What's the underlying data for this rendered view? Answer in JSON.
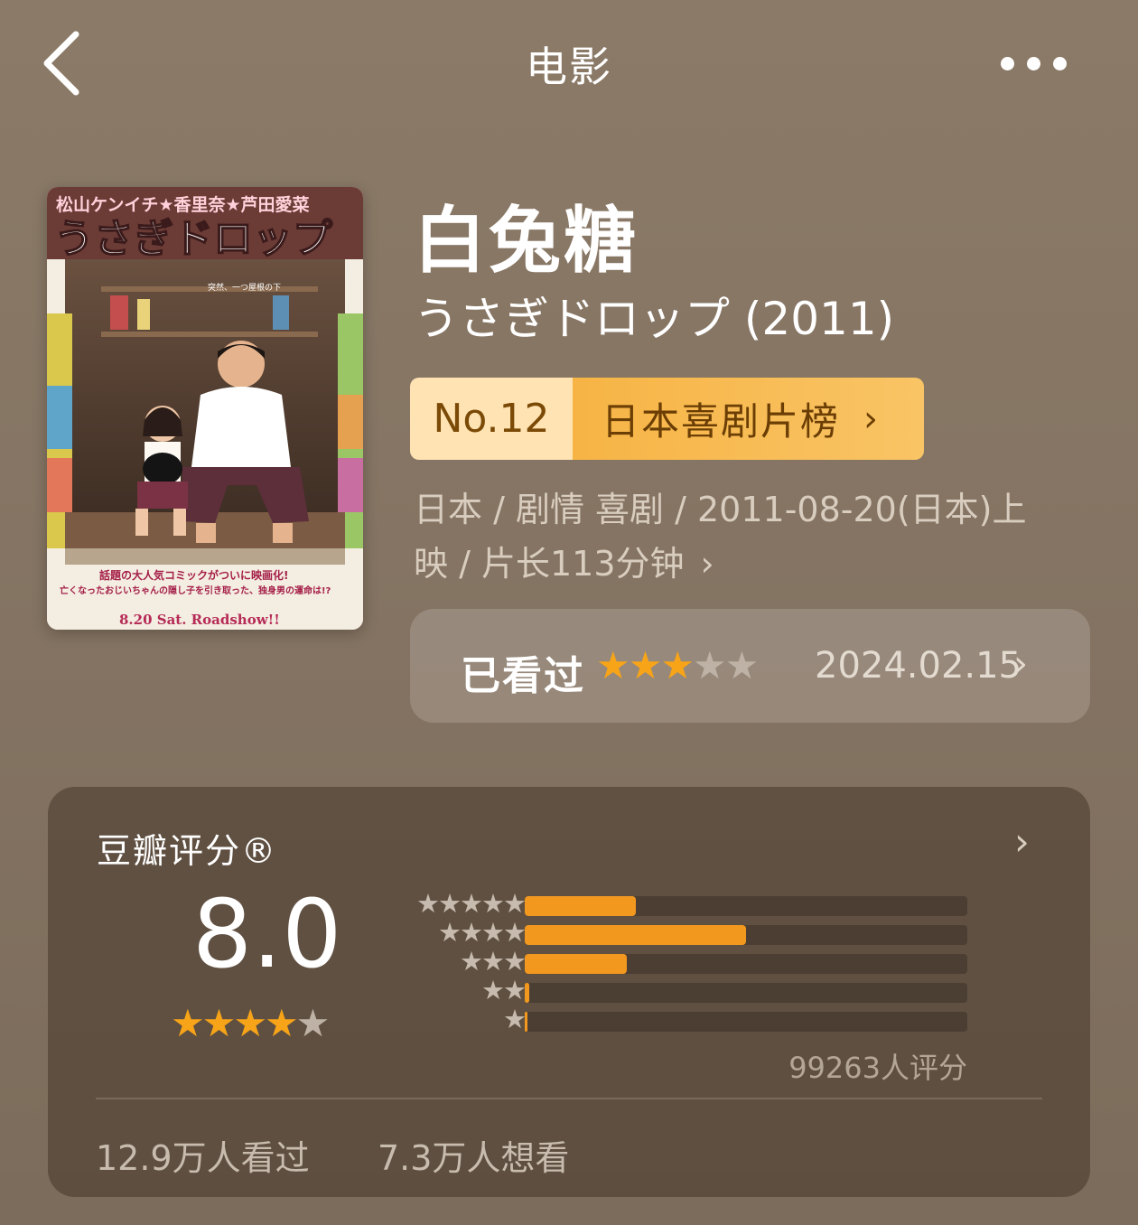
{
  "header": {
    "back_icon": "chevron-left-icon",
    "title": "电影",
    "more_icon": "more-dots-icon"
  },
  "poster": {
    "cast_line": "松山ケンイチ★香里奈★芦田愛菜",
    "title_jp": "うさぎドロップ",
    "tagline": "突然、一つ屋根の下",
    "promo_line1": "話題の大人気コミックがついに映画化!",
    "promo_line2": "亡くなったおじいちゃんの隠し子を引き取った、独身男の運命は!?",
    "release": "8.20 Sat. Roadshow!!"
  },
  "movie": {
    "title": "白兔糖",
    "subtitle": "うさぎドロップ  (2011)"
  },
  "rank": {
    "number": "No.12",
    "list_name": "日本喜剧片榜",
    "chevron": "›"
  },
  "meta": {
    "line1": "日本  /  剧情  喜剧  /  2011-08-20(日本)上",
    "line2": "映  /  片长113分钟",
    "chevron": "›"
  },
  "watched": {
    "label": "已看过",
    "user_rating": 3,
    "max_rating": 5,
    "date": "2024.02.15",
    "chevron": "›"
  },
  "rating": {
    "title": "豆瓣评分®",
    "chevron": "›",
    "score": "8.0",
    "score_stars": 4,
    "distribution": [
      {
        "stars": 5,
        "fraction": 0.25
      },
      {
        "stars": 4,
        "fraction": 0.5
      },
      {
        "stars": 3,
        "fraction": 0.23
      },
      {
        "stars": 2,
        "fraction": 0.01
      },
      {
        "stars": 1,
        "fraction": 0.002
      }
    ],
    "count": "99263人评分",
    "watched_count": "12.9万人看过",
    "want_count": "7.3万人想看"
  },
  "colors": {
    "background": "#857463",
    "accent_orange": "#f2981e",
    "rank_light": "#ffe3b3",
    "rank_dark": "#f7b445"
  }
}
